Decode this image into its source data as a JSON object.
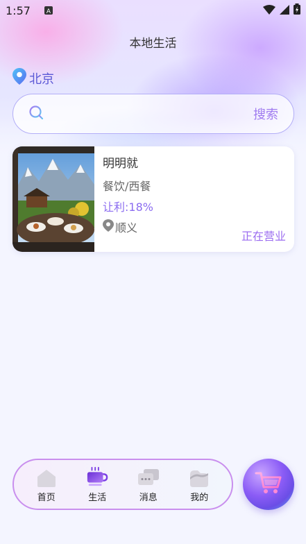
{
  "status_bar": {
    "time": "1:57",
    "notification_icon": "a-badge-icon"
  },
  "header": {
    "title": "本地生活"
  },
  "location": {
    "city": "北京"
  },
  "search": {
    "placeholder": "",
    "button_label": "搜索"
  },
  "shops": [
    {
      "name": "明明就",
      "category": "餐饮/西餐",
      "rebate": "让利:18%",
      "area": "顺义",
      "status": "正在营业"
    }
  ],
  "tabbar": {
    "items": [
      {
        "label": "首页",
        "icon": "home-icon",
        "active": false
      },
      {
        "label": "生活",
        "icon": "coffee-cup-icon",
        "active": true
      },
      {
        "label": "消息",
        "icon": "chat-bubbles-icon",
        "active": false
      },
      {
        "label": "我的",
        "icon": "profile-icon",
        "active": false
      }
    ]
  },
  "colors": {
    "accent": "#8b6cf0",
    "tab_active": "#7b3fe4",
    "tab_border": "#c98fee"
  }
}
